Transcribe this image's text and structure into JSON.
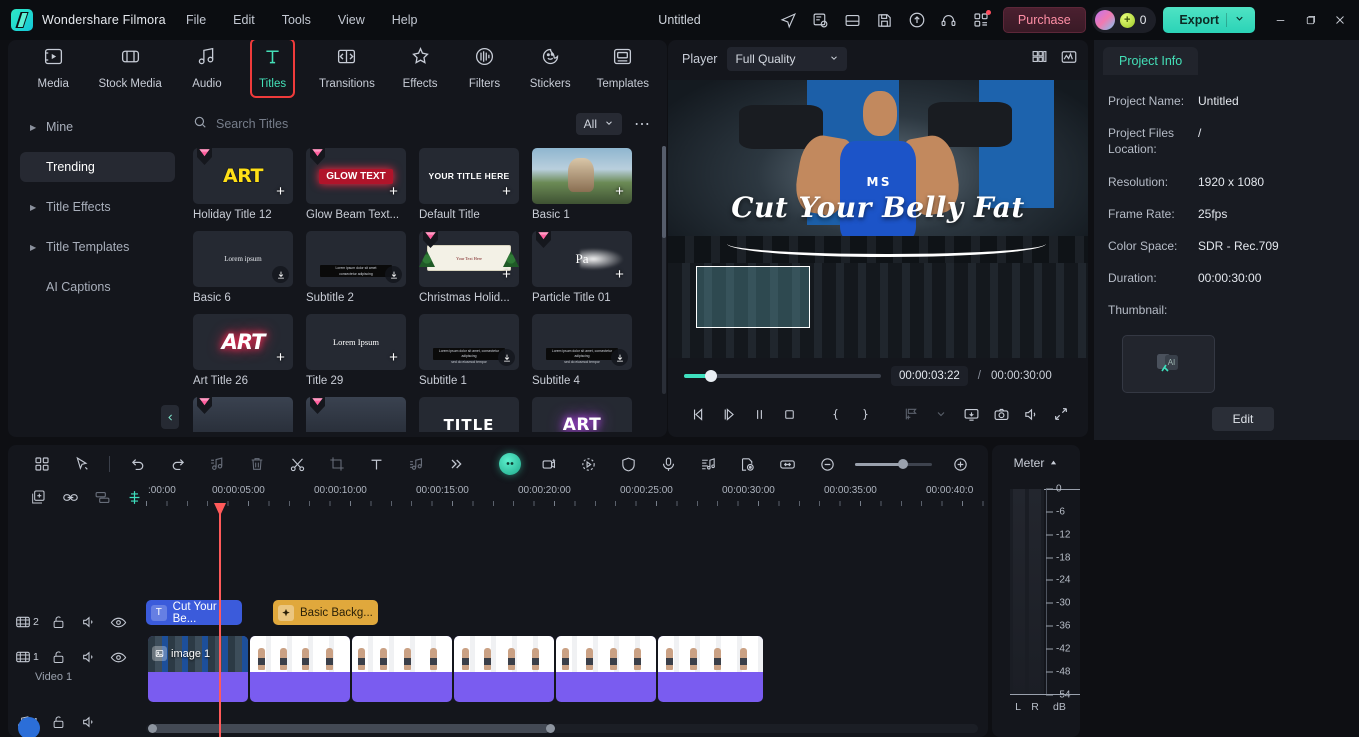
{
  "titlebar": {
    "brand": "Wondershare Filmora",
    "menus": [
      "File",
      "Edit",
      "Tools",
      "View",
      "Help"
    ],
    "document_title": "Untitled",
    "icons": [
      "send-icon",
      "export-list-icon",
      "layout-icon",
      "save-icon",
      "cloud-upload-icon",
      "headset-icon",
      "apps-grid-icon"
    ],
    "purchase_label": "Purchase",
    "credits_count": "0",
    "export_label": "Export",
    "window_controls": [
      "minimize",
      "maximize",
      "close"
    ]
  },
  "library": {
    "tabs": [
      {
        "label": "Media",
        "icon": "media-icon"
      },
      {
        "label": "Stock Media",
        "icon": "stock-media-icon"
      },
      {
        "label": "Audio",
        "icon": "audio-icon"
      },
      {
        "label": "Titles",
        "icon": "titles-icon"
      },
      {
        "label": "Transitions",
        "icon": "transitions-icon"
      },
      {
        "label": "Effects",
        "icon": "effects-icon"
      },
      {
        "label": "Filters",
        "icon": "filters-icon"
      },
      {
        "label": "Stickers",
        "icon": "stickers-icon"
      },
      {
        "label": "Templates",
        "icon": "templates-icon"
      }
    ],
    "active_tab": "Titles",
    "sidebar": [
      {
        "label": "Mine",
        "expandable": true
      },
      {
        "label": "Trending",
        "expandable": false
      },
      {
        "label": "Title Effects",
        "expandable": true
      },
      {
        "label": "Title Templates",
        "expandable": true
      },
      {
        "label": "AI Captions",
        "expandable": false
      }
    ],
    "active_sidebar": "Trending",
    "search_placeholder": "Search Titles",
    "filter_label": "All",
    "tiles": [
      {
        "name": "Holiday Title 12",
        "preview": "ART",
        "badge": "add",
        "premium": true,
        "style": "art-yellow"
      },
      {
        "name": "Glow Beam Text...",
        "preview": "GLOW TEXT",
        "badge": "add",
        "premium": true,
        "style": "glow-red"
      },
      {
        "name": "Default Title",
        "preview": "YOUR TITLE HERE",
        "badge": "add",
        "premium": false,
        "style": "plain-white"
      },
      {
        "name": "Basic 1",
        "preview": "",
        "badge": "add",
        "premium": false,
        "style": "photo-outdoor"
      },
      {
        "name": "Basic 6",
        "preview": "Lorem ipsum",
        "badge": "download",
        "premium": false,
        "style": "lorem-small"
      },
      {
        "name": "Subtitle 2",
        "preview": "",
        "badge": "download",
        "premium": false,
        "style": "subtitle-bar"
      },
      {
        "name": "Christmas Holid...",
        "preview": "Your Text Here",
        "badge": "add",
        "premium": true,
        "style": "xmas-banner"
      },
      {
        "name": "Particle Title 01",
        "preview": "Pa",
        "badge": "add",
        "premium": true,
        "style": "particle"
      },
      {
        "name": "Art Title 26",
        "preview": "ART",
        "badge": "add",
        "premium": false,
        "style": "art-neon"
      },
      {
        "name": "Title 29",
        "preview": "Lorem Ipsum",
        "badge": "add",
        "premium": false,
        "style": "lorem-serif"
      },
      {
        "name": "Subtitle 1",
        "preview": "",
        "badge": "download",
        "premium": false,
        "style": "subtitle-bar"
      },
      {
        "name": "Subtitle 4",
        "preview": "",
        "badge": "download",
        "premium": false,
        "style": "subtitle-bar"
      },
      {
        "name": "",
        "preview": "",
        "badge": "",
        "premium": true,
        "style": "dim"
      },
      {
        "name": "",
        "preview": "",
        "badge": "",
        "premium": true,
        "style": "dim"
      },
      {
        "name": "",
        "preview": "TITLE",
        "badge": "",
        "premium": false,
        "style": "title-white"
      },
      {
        "name": "",
        "preview": "ART",
        "badge": "",
        "premium": false,
        "style": "pink-glow"
      }
    ]
  },
  "player": {
    "label": "Player",
    "quality": "Full Quality",
    "overlay_title": "Cut Your Belly Fat",
    "current_time": "00:00:03:22",
    "separator": "/",
    "total_time": "00:00:30:00",
    "controls": [
      "prev-frame-icon",
      "play-icon",
      "pause-icon",
      "stop-icon",
      "mark-in-icon",
      "mark-out-icon",
      "add-marker-icon",
      "chevron-down-icon",
      "screen-icon",
      "snapshot-icon",
      "volume-icon",
      "fullscreen-icon"
    ],
    "head_icons": [
      "grid-view-icon",
      "waveform-icon"
    ]
  },
  "project_info": {
    "tab_label": "Project Info",
    "rows": [
      {
        "key": "Project Name:",
        "value": "Untitled"
      },
      {
        "key": "Project Files Location:",
        "value": "/"
      },
      {
        "key": "Resolution:",
        "value": "1920 x 1080"
      },
      {
        "key": "Frame Rate:",
        "value": "25fps"
      },
      {
        "key": "Color Space:",
        "value": "SDR - Rec.709"
      },
      {
        "key": "Duration:",
        "value": "00:00:30:00"
      },
      {
        "key": "Thumbnail:",
        "value": ""
      }
    ],
    "edit_label": "Edit"
  },
  "timeline": {
    "tools": [
      "grid-icon",
      "cursor-icon",
      "undo-icon",
      "redo-icon",
      "audio-detach-icon",
      "delete-icon",
      "split-icon",
      "crop-icon",
      "text-icon",
      "audio-mix-icon",
      "more-icon"
    ],
    "tools_right": [
      "ai-tools-icon",
      "motion-tracking-icon",
      "speed-icon",
      "mask-icon",
      "voiceover-icon",
      "audio-ducking-icon",
      "marker-icon",
      "fit-timeline-icon",
      "zoom-out-icon",
      "zoom-in-icon"
    ],
    "second_row": [
      "add-track-icon",
      "link-icon",
      "group-icon",
      "snap-icon"
    ],
    "ruler_labels": [
      ":00:00",
      "00:00:05:00",
      "00:00:10:00",
      "00:00:15:00",
      "00:00:20:00",
      "00:00:25:00",
      "00:00:30:00",
      "00:00:35:00",
      "00:00:40:0"
    ],
    "tracks": [
      {
        "id": "2",
        "type": "video",
        "name": "",
        "icons": [
          "film-icon",
          "unlock-icon",
          "mute-icon",
          "eye-icon"
        ]
      },
      {
        "id": "1",
        "type": "video",
        "name": "Video 1",
        "icons": [
          "film-icon",
          "unlock-icon",
          "mute-icon",
          "eye-icon"
        ]
      },
      {
        "id": "1",
        "type": "audio",
        "name": "",
        "icons": [
          "music-icon",
          "unlock-icon",
          "mute-icon"
        ]
      }
    ],
    "clips": [
      {
        "track": 2,
        "label": "Cut Your Be...",
        "kind": "text"
      },
      {
        "track": 2,
        "label": "Basic Backg...",
        "kind": "effect"
      },
      {
        "track": 1,
        "label": "image 1",
        "kind": "video"
      },
      {
        "track": 1,
        "label": "",
        "kind": "video"
      },
      {
        "track": 1,
        "label": "",
        "kind": "video"
      },
      {
        "track": 1,
        "label": "",
        "kind": "video"
      },
      {
        "track": 1,
        "label": "",
        "kind": "video"
      }
    ]
  },
  "meter": {
    "title": "Meter",
    "scale": [
      "0",
      "-6",
      "-12",
      "-18",
      "-24",
      "-30",
      "-36",
      "-42",
      "-48",
      "-54"
    ],
    "channels": [
      "L",
      "R"
    ],
    "unit": "dB"
  },
  "colors": {
    "accent": "#44e0b8",
    "highlight": "#ef3b3b",
    "playhead": "#ff5a5a",
    "clip_text": "#3b5bdb",
    "clip_effect": "#e0a83c",
    "clip_video": "#7a5cf0"
  }
}
